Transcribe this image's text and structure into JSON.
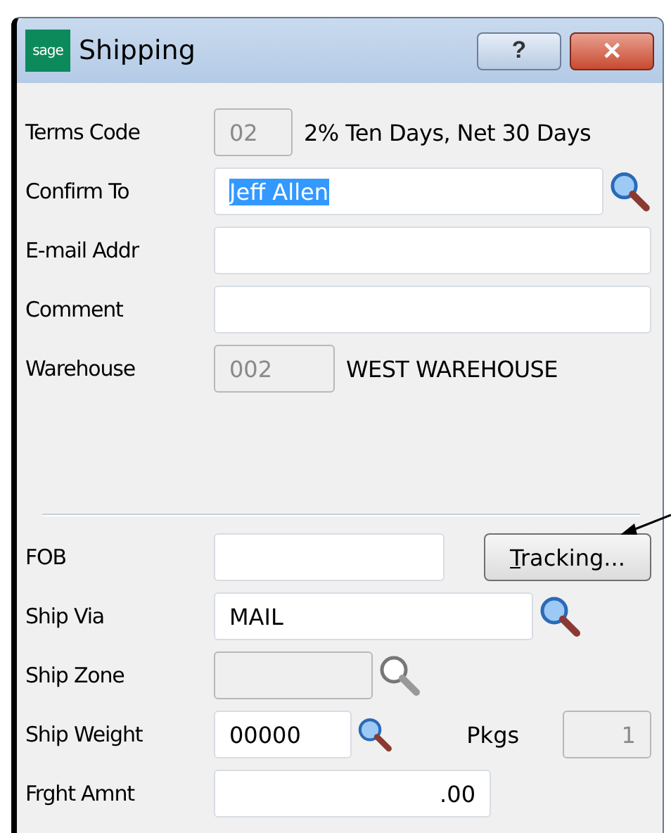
{
  "window": {
    "logo": "sage",
    "title": "Shipping",
    "buttons": [
      {
        "kind": "help",
        "label": "?"
      },
      {
        "kind": "close",
        "label": "✕"
      }
    ]
  },
  "top_rows": [
    {
      "label": "Terms Code",
      "field": {
        "value": "02",
        "disabled": true
      },
      "description": "2% Ten Days, Net 30 Days"
    },
    {
      "label": "Confirm To",
      "field": {
        "value": "Jeff Allen",
        "disabled": false,
        "highlighted": true
      },
      "lookup": {
        "enabled": true
      }
    },
    {
      "label": "E-mail Addr",
      "field": {
        "disabled": false
      }
    },
    {
      "label": "Comment",
      "field": {
        "disabled": false
      }
    },
    {
      "label": "Warehouse",
      "field": {
        "value": "002",
        "disabled": true
      },
      "description": "WEST WAREHOUSE"
    }
  ],
  "bottom_rows": [
    {
      "label": "FOB",
      "field": {
        "disabled": false
      },
      "button": "Tracking..."
    },
    {
      "label": "Ship Via",
      "field": {
        "value": "MAIL",
        "disabled": false
      },
      "lookup": {
        "enabled": true
      }
    },
    {
      "label": "Ship Zone",
      "field": {
        "disabled": true
      },
      "lookup": {
        "enabled": false
      }
    },
    {
      "label": "Ship Weight",
      "field": {
        "value": "00000",
        "disabled": false
      },
      "lookup": {
        "enabled": true
      },
      "extra": {
        "label": "Pkgs",
        "value": "1",
        "disabled": true
      }
    },
    {
      "label": "Frght Amnt",
      "field": {
        "value": ".00",
        "disabled": false,
        "numeric": true
      }
    }
  ]
}
